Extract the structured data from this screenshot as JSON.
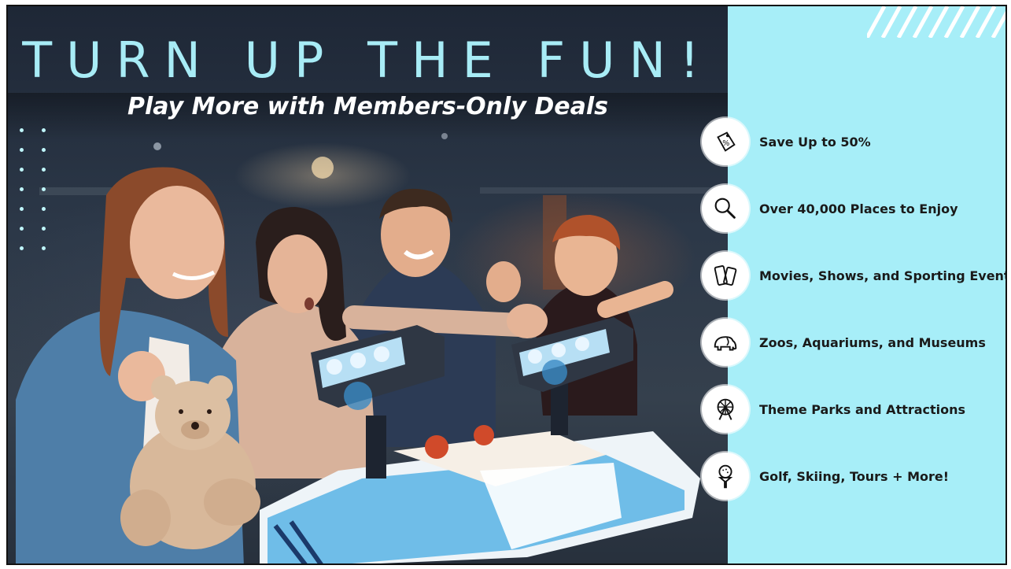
{
  "headline": "TURN UP THE FUN!",
  "subheadline": "Play More with Members-Only Deals",
  "features": [
    {
      "icon": "discount-tag-icon",
      "label": "Save Up to 50%"
    },
    {
      "icon": "magnifier-icon",
      "label": "Over 40,000 Places to Enjoy"
    },
    {
      "icon": "tickets-icon",
      "label": "Movies, Shows, and Sporting Events"
    },
    {
      "icon": "elephant-icon",
      "label": "Zoos, Aquariums, and Museums"
    },
    {
      "icon": "ferris-wheel-icon",
      "label": "Theme Parks and Attractions"
    },
    {
      "icon": "golf-ball-tee-icon",
      "label": "Golf, Skiing, Tours + More!"
    }
  ],
  "colors": {
    "panel": "#a7eef8",
    "headline": "#a8ecf6",
    "subheadline": "#ffffff",
    "label": "#1a1a1a"
  }
}
